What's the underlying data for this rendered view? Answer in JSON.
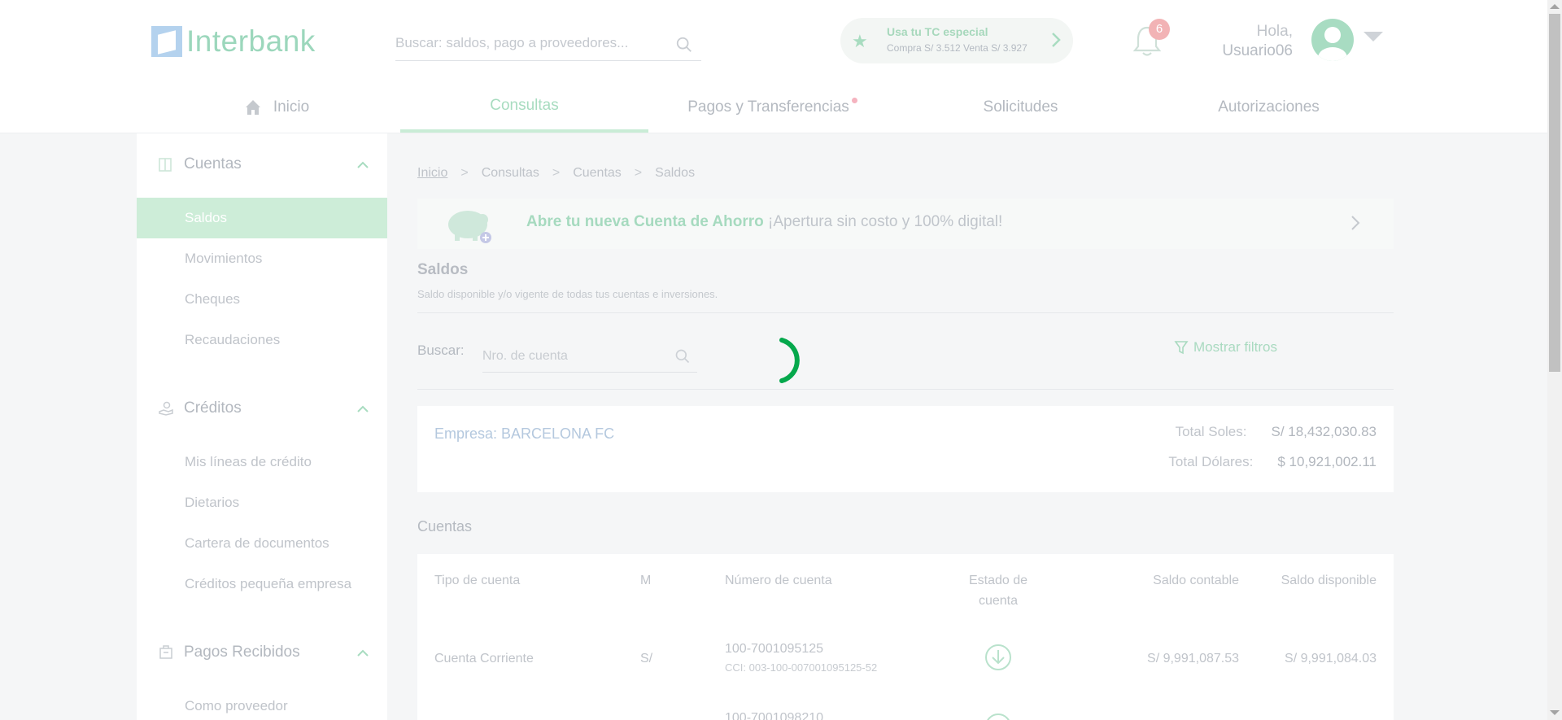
{
  "header": {
    "logo_text": "Interbank",
    "search_placeholder": "Buscar: saldos, pago a proveedores...",
    "tc": {
      "title": "Usa tu TC especial",
      "rates": "Compra S/ 3.512   Venta S/ 3.927"
    },
    "notifications_count": "6",
    "greeting": "Hola,",
    "user_name": "Usuario06"
  },
  "nav": {
    "items": [
      {
        "label": "Inicio"
      },
      {
        "label": "Consultas"
      },
      {
        "label": "Pagos y Transferencias"
      },
      {
        "label": "Solicitudes"
      },
      {
        "label": "Autorizaciones"
      }
    ]
  },
  "sidebar": {
    "sections": [
      {
        "title": "Cuentas",
        "items": [
          "Saldos",
          "Movimientos",
          "Cheques",
          "Recaudaciones"
        ]
      },
      {
        "title": "Créditos",
        "items": [
          "Mis líneas de crédito",
          "Dietarios",
          "Cartera de documentos",
          "Créditos pequeña empresa"
        ]
      },
      {
        "title": "Pagos Recibidos",
        "items": [
          "Como proveedor"
        ]
      }
    ]
  },
  "breadcrumb": [
    "Inicio",
    "Consultas",
    "Cuentas",
    "Saldos"
  ],
  "promo": {
    "bold": "Abre tu nueva Cuenta de Ahorro",
    "text": " ¡Apertura sin costo y 100% digital!"
  },
  "saldos": {
    "title": "Saldos",
    "subtitle": "Saldo disponible y/o vigente de todas tus cuentas e inversiones."
  },
  "filter": {
    "label": "Buscar:",
    "placeholder": "Nro. de cuenta",
    "toggle_label": "Mostrar filtros"
  },
  "company": {
    "name": "Empresa: BARCELONA FC",
    "total_soles_label": "Total Soles:",
    "total_soles_value": "S/ 18,432,030.83",
    "total_dolares_label": "Total Dólares:",
    "total_dolares_value": "$ 10,921,002.11"
  },
  "cuentas": {
    "title": "Cuentas",
    "headers": {
      "tipo": "Tipo de cuenta",
      "moneda": "M",
      "numero": "Número de cuenta",
      "estado_1": "Estado de",
      "estado_2": "cuenta",
      "contable": "Saldo contable",
      "disponible": "Saldo disponible"
    },
    "rows": [
      {
        "tipo": "Cuenta Corriente",
        "moneda": "S/",
        "numero": "100-7001095125",
        "cci": "CCI: 003-100-007001095125-52",
        "contable": "S/ 9,991,087.53",
        "disponible": "S/ 9,991,084.03"
      },
      {
        "numero": "100-7001098210"
      }
    ]
  },
  "colors": {
    "brand_green": "#05a84c",
    "accent_light": "#a8dcc0",
    "active_bg": "#cdedd8"
  }
}
